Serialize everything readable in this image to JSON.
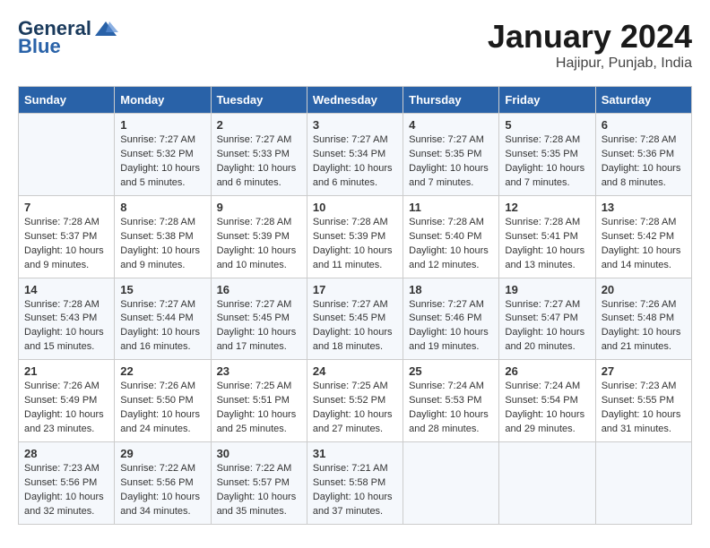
{
  "header": {
    "logo_line1": "General",
    "logo_line2": "Blue",
    "month_title": "January 2024",
    "location": "Hajipur, Punjab, India"
  },
  "days_of_week": [
    "Sunday",
    "Monday",
    "Tuesday",
    "Wednesday",
    "Thursday",
    "Friday",
    "Saturday"
  ],
  "weeks": [
    [
      {
        "day": "",
        "content": ""
      },
      {
        "day": "1",
        "content": "Sunrise: 7:27 AM\nSunset: 5:32 PM\nDaylight: 10 hours\nand 5 minutes."
      },
      {
        "day": "2",
        "content": "Sunrise: 7:27 AM\nSunset: 5:33 PM\nDaylight: 10 hours\nand 6 minutes."
      },
      {
        "day": "3",
        "content": "Sunrise: 7:27 AM\nSunset: 5:34 PM\nDaylight: 10 hours\nand 6 minutes."
      },
      {
        "day": "4",
        "content": "Sunrise: 7:27 AM\nSunset: 5:35 PM\nDaylight: 10 hours\nand 7 minutes."
      },
      {
        "day": "5",
        "content": "Sunrise: 7:28 AM\nSunset: 5:35 PM\nDaylight: 10 hours\nand 7 minutes."
      },
      {
        "day": "6",
        "content": "Sunrise: 7:28 AM\nSunset: 5:36 PM\nDaylight: 10 hours\nand 8 minutes."
      }
    ],
    [
      {
        "day": "7",
        "content": "Sunrise: 7:28 AM\nSunset: 5:37 PM\nDaylight: 10 hours\nand 9 minutes."
      },
      {
        "day": "8",
        "content": "Sunrise: 7:28 AM\nSunset: 5:38 PM\nDaylight: 10 hours\nand 9 minutes."
      },
      {
        "day": "9",
        "content": "Sunrise: 7:28 AM\nSunset: 5:39 PM\nDaylight: 10 hours\nand 10 minutes."
      },
      {
        "day": "10",
        "content": "Sunrise: 7:28 AM\nSunset: 5:39 PM\nDaylight: 10 hours\nand 11 minutes."
      },
      {
        "day": "11",
        "content": "Sunrise: 7:28 AM\nSunset: 5:40 PM\nDaylight: 10 hours\nand 12 minutes."
      },
      {
        "day": "12",
        "content": "Sunrise: 7:28 AM\nSunset: 5:41 PM\nDaylight: 10 hours\nand 13 minutes."
      },
      {
        "day": "13",
        "content": "Sunrise: 7:28 AM\nSunset: 5:42 PM\nDaylight: 10 hours\nand 14 minutes."
      }
    ],
    [
      {
        "day": "14",
        "content": "Sunrise: 7:28 AM\nSunset: 5:43 PM\nDaylight: 10 hours\nand 15 minutes."
      },
      {
        "day": "15",
        "content": "Sunrise: 7:27 AM\nSunset: 5:44 PM\nDaylight: 10 hours\nand 16 minutes."
      },
      {
        "day": "16",
        "content": "Sunrise: 7:27 AM\nSunset: 5:45 PM\nDaylight: 10 hours\nand 17 minutes."
      },
      {
        "day": "17",
        "content": "Sunrise: 7:27 AM\nSunset: 5:45 PM\nDaylight: 10 hours\nand 18 minutes."
      },
      {
        "day": "18",
        "content": "Sunrise: 7:27 AM\nSunset: 5:46 PM\nDaylight: 10 hours\nand 19 minutes."
      },
      {
        "day": "19",
        "content": "Sunrise: 7:27 AM\nSunset: 5:47 PM\nDaylight: 10 hours\nand 20 minutes."
      },
      {
        "day": "20",
        "content": "Sunrise: 7:26 AM\nSunset: 5:48 PM\nDaylight: 10 hours\nand 21 minutes."
      }
    ],
    [
      {
        "day": "21",
        "content": "Sunrise: 7:26 AM\nSunset: 5:49 PM\nDaylight: 10 hours\nand 23 minutes."
      },
      {
        "day": "22",
        "content": "Sunrise: 7:26 AM\nSunset: 5:50 PM\nDaylight: 10 hours\nand 24 minutes."
      },
      {
        "day": "23",
        "content": "Sunrise: 7:25 AM\nSunset: 5:51 PM\nDaylight: 10 hours\nand 25 minutes."
      },
      {
        "day": "24",
        "content": "Sunrise: 7:25 AM\nSunset: 5:52 PM\nDaylight: 10 hours\nand 27 minutes."
      },
      {
        "day": "25",
        "content": "Sunrise: 7:24 AM\nSunset: 5:53 PM\nDaylight: 10 hours\nand 28 minutes."
      },
      {
        "day": "26",
        "content": "Sunrise: 7:24 AM\nSunset: 5:54 PM\nDaylight: 10 hours\nand 29 minutes."
      },
      {
        "day": "27",
        "content": "Sunrise: 7:23 AM\nSunset: 5:55 PM\nDaylight: 10 hours\nand 31 minutes."
      }
    ],
    [
      {
        "day": "28",
        "content": "Sunrise: 7:23 AM\nSunset: 5:56 PM\nDaylight: 10 hours\nand 32 minutes."
      },
      {
        "day": "29",
        "content": "Sunrise: 7:22 AM\nSunset: 5:56 PM\nDaylight: 10 hours\nand 34 minutes."
      },
      {
        "day": "30",
        "content": "Sunrise: 7:22 AM\nSunset: 5:57 PM\nDaylight: 10 hours\nand 35 minutes."
      },
      {
        "day": "31",
        "content": "Sunrise: 7:21 AM\nSunset: 5:58 PM\nDaylight: 10 hours\nand 37 minutes."
      },
      {
        "day": "",
        "content": ""
      },
      {
        "day": "",
        "content": ""
      },
      {
        "day": "",
        "content": ""
      }
    ]
  ]
}
